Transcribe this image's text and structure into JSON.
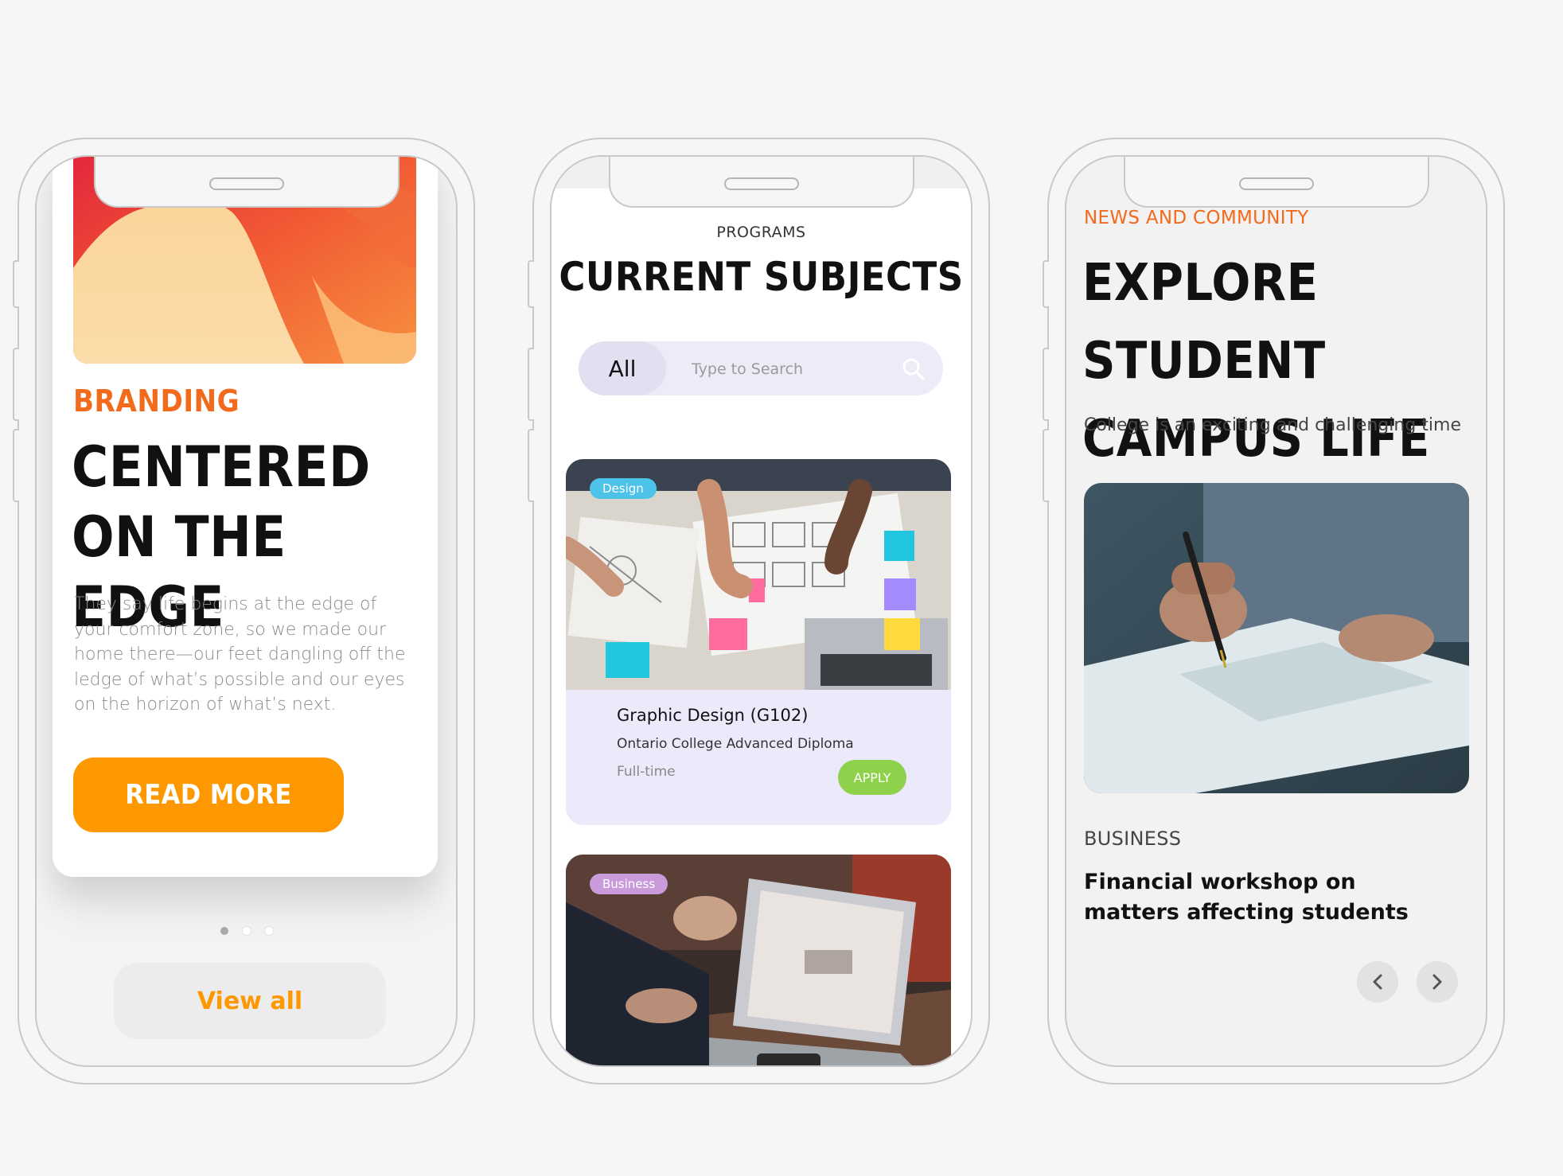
{
  "phone1": {
    "kicker": "BRANDING",
    "title_line1": "CENTERED",
    "title_line2": "ON THE EDGE",
    "body": "They say life begins at the edge of your comfort zone, so we made our home there—our feet dangling off the ledge of what’s possible and our eyes on the horizon of what’s next.",
    "read_more": "READ MORE",
    "view_all": "View all",
    "pagination": {
      "total": 3,
      "active": 0
    },
    "colors": {
      "accent": "#fd9800",
      "kicker": "#f26a1b"
    }
  },
  "phone2": {
    "kicker": "PROGRAMS",
    "title": "CURRENT SUBJECTS",
    "search": {
      "segment": "All",
      "placeholder": "Type to Search"
    },
    "courses": [
      {
        "tag": "Design",
        "title": "Graphic Design (G102)",
        "subtitle": "Ontario College Advanced Diploma",
        "schedule": "Full-time",
        "action": "APPLY"
      },
      {
        "tag": "Business"
      }
    ],
    "colors": {
      "apply": "#8dd24a",
      "card": "#ece9fb",
      "design_tag": "#4ec3ea",
      "business_tag": "#c99bdb"
    }
  },
  "phone3": {
    "kicker": "NEWS AND COMMUNITY",
    "title_line1": "EXPLORE STUDENT",
    "title_line2": "CAMPUS LIFE",
    "subtitle": "College is an exciting and challenging time",
    "category": "BUSINESS",
    "headline": "Financial workshop on matters affecting students",
    "nav": {
      "prev_icon": "chevron-left-icon",
      "next_icon": "chevron-right-icon"
    }
  }
}
